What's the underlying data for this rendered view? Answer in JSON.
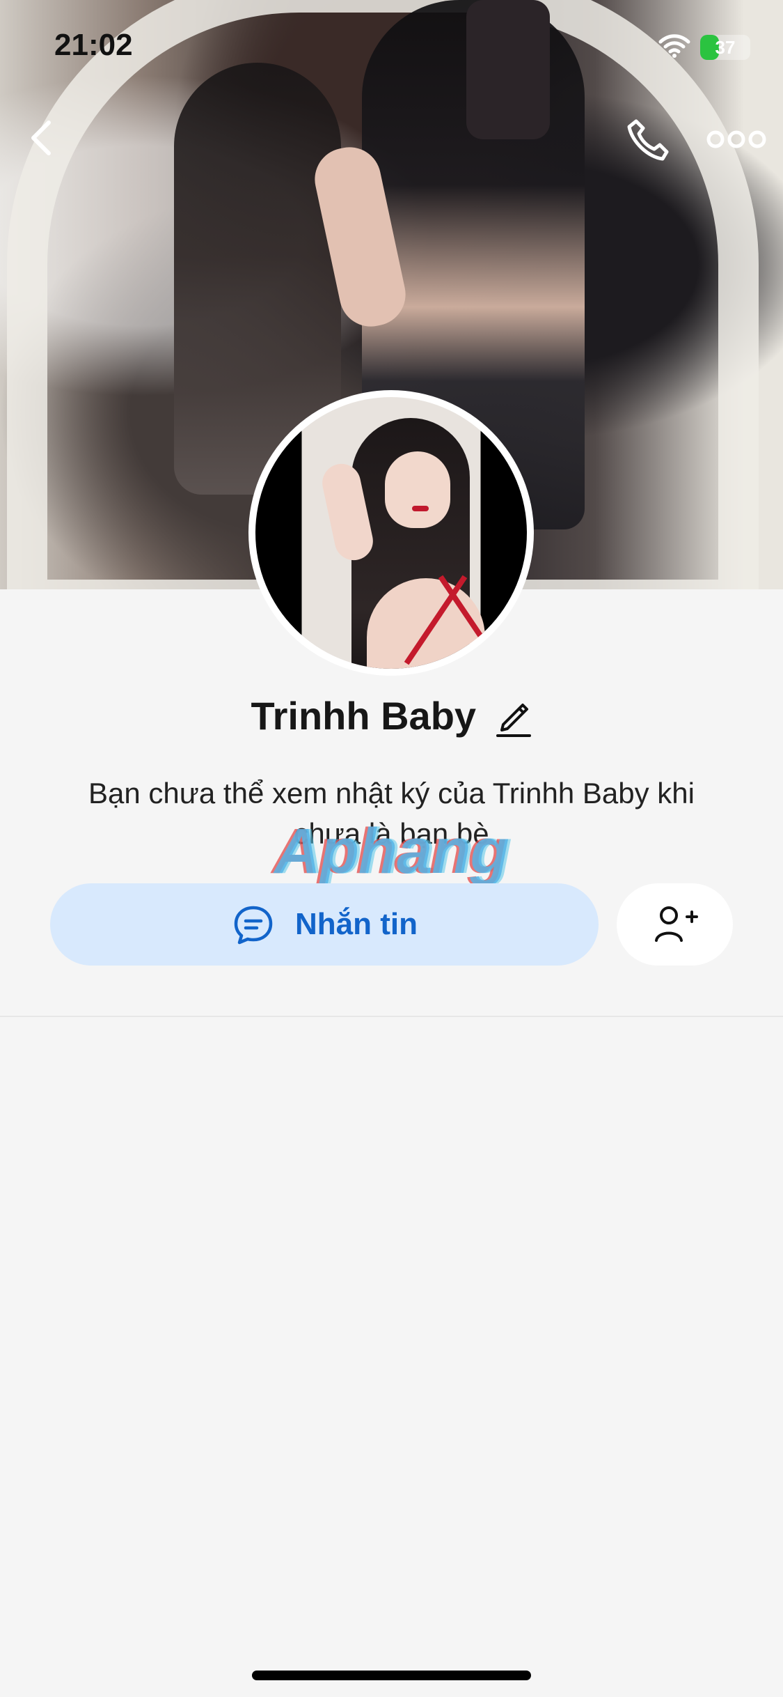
{
  "status_bar": {
    "time": "21:02",
    "battery_level": 37,
    "battery_text": "37",
    "wifi_icon": "wifi-icon",
    "charging_icon": "lightning-bolt-icon"
  },
  "top_nav": {
    "back_icon": "chevron-left-icon",
    "call_icon": "phone-icon",
    "more_icon": "ellipsis-icon"
  },
  "profile": {
    "name": "Trinhh Baby",
    "notice": "Bạn chưa thể xem nhật ký của Trinhh Baby khi chưa là bạn bè"
  },
  "actions": {
    "message_label": "Nhắn tin",
    "message_icon": "chat-bubble-icon",
    "add_friend_icon": "add-user-icon"
  },
  "watermark": {
    "text": "Aphang"
  },
  "colors": {
    "primary_blue": "#1264ca",
    "message_button_bg": "#d8e9fd",
    "page_bg": "#f5f5f5",
    "battery_green": "#2bc340"
  }
}
